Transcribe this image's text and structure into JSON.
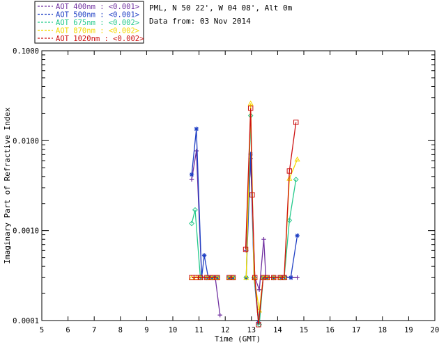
{
  "header": {
    "site_line": "PML, N 50 22', W 04 08', Alt 0m",
    "date_line": "Data from: 03 Nov 2014"
  },
  "chart_data": {
    "type": "line",
    "xlabel": "Time (GMT)",
    "ylabel": "Imaginary Part of Refractive Index",
    "xlim": [
      5,
      20
    ],
    "ylim": [
      0.0001,
      0.1
    ],
    "yscale": "log",
    "xticks": [
      "5",
      "6",
      "7",
      "8",
      "9",
      "10",
      "11",
      "12",
      "13",
      "14",
      "15",
      "16",
      "17",
      "18",
      "19",
      "20"
    ],
    "yticks": [
      "0.0001",
      "0.0010",
      "0.0100",
      "0.1000"
    ],
    "legend_position": "top-left, outside plot",
    "series": [
      {
        "name": "AOT  400nm : <0.001>",
        "color": "#7030a0",
        "marker": "plus",
        "points": [
          [
            10.72,
            0.0037
          ],
          [
            10.9,
            0.0077
          ],
          [
            11.1,
            0.0003
          ],
          [
            11.27,
            0.0003
          ],
          [
            11.45,
            0.0003
          ],
          [
            11.62,
            0.0003
          ],
          [
            11.8,
            0.000115
          ],
          [
            null,
            null
          ],
          [
            12.15,
            0.0003
          ],
          [
            12.3,
            0.0003
          ],
          [
            null,
            null
          ],
          [
            12.8,
            0.0006
          ],
          [
            12.97,
            0.0063
          ],
          [
            13.13,
            0.0003
          ],
          [
            13.3,
            0.00022
          ],
          [
            13.47,
            0.0008
          ],
          [
            13.55,
            0.0003
          ],
          [
            13.85,
            0.0003
          ],
          [
            14.05,
            0.0003
          ],
          [
            14.25,
            0.0003
          ],
          [
            14.55,
            0.0003
          ],
          [
            14.75,
            0.0003
          ]
        ]
      },
      {
        "name": "AOT  500nm : <0.001>",
        "color": "#1f3fc4",
        "marker": "asterisk",
        "points": [
          [
            10.72,
            0.0042
          ],
          [
            10.9,
            0.0135
          ],
          [
            11.1,
            0.0003
          ],
          [
            11.2,
            0.00053
          ],
          [
            11.35,
            0.0003
          ],
          [
            11.5,
            0.0003
          ],
          [
            11.7,
            0.0003
          ],
          [
            null,
            null
          ],
          [
            12.15,
            0.0003
          ],
          [
            12.3,
            0.0003
          ],
          [
            null,
            null
          ],
          [
            12.8,
            0.0003
          ],
          [
            12.97,
            0.0071
          ],
          [
            13.1,
            0.0003
          ],
          [
            13.27,
            9.5e-05
          ],
          [
            13.45,
            0.0003
          ],
          [
            13.6,
            0.0003
          ],
          [
            13.85,
            0.0003
          ],
          [
            14.15,
            0.0003
          ],
          [
            14.3,
            0.0003
          ],
          [
            14.5,
            0.0003
          ],
          [
            14.75,
            0.00088
          ]
        ]
      },
      {
        "name": "AOT  675nm : <0.002>",
        "color": "#22c98a",
        "marker": "diamond",
        "points": [
          [
            10.72,
            0.0012
          ],
          [
            10.85,
            0.0017
          ],
          [
            11.05,
            0.0003
          ],
          [
            11.3,
            0.0003
          ],
          [
            11.5,
            0.0003
          ],
          [
            11.7,
            0.0003
          ],
          [
            null,
            null
          ],
          [
            12.15,
            0.0003
          ],
          [
            12.3,
            0.0003
          ],
          [
            null,
            null
          ],
          [
            12.8,
            0.0003
          ],
          [
            12.97,
            0.019
          ],
          [
            13.1,
            0.0003
          ],
          [
            13.3,
            9e-05
          ],
          [
            13.45,
            0.0003
          ],
          [
            13.6,
            0.0003
          ],
          [
            13.85,
            0.0003
          ],
          [
            14.1,
            0.0003
          ],
          [
            14.25,
            0.0003
          ],
          [
            14.45,
            0.0013
          ],
          [
            14.7,
            0.0037
          ]
        ]
      },
      {
        "name": "AOT  870nm : <0.002>",
        "color": "#f5d800",
        "marker": "triangle",
        "points": [
          [
            10.72,
            0.0003
          ],
          [
            10.9,
            0.0003
          ],
          [
            11.05,
            0.0003
          ],
          [
            11.3,
            0.0003
          ],
          [
            11.5,
            0.0003
          ],
          [
            11.7,
            0.0003
          ],
          [
            null,
            null
          ],
          [
            12.15,
            0.0003
          ],
          [
            12.3,
            0.0003
          ],
          [
            null,
            null
          ],
          [
            12.8,
            0.0003
          ],
          [
            12.97,
            0.026
          ],
          [
            13.1,
            0.0003
          ],
          [
            13.3,
            0.00013
          ],
          [
            13.45,
            0.0003
          ],
          [
            13.6,
            0.0003
          ],
          [
            13.85,
            0.0003
          ],
          [
            14.1,
            0.0003
          ],
          [
            14.25,
            0.0003
          ],
          [
            14.45,
            0.0038
          ],
          [
            14.75,
            0.0062
          ]
        ]
      },
      {
        "name": "AOT 1020nm : <0.002>",
        "color": "#cc1010",
        "marker": "square",
        "points": [
          [
            10.72,
            0.0003
          ],
          [
            10.9,
            0.0003
          ],
          [
            11.05,
            0.0003
          ],
          [
            11.3,
            0.0003
          ],
          [
            11.5,
            0.0003
          ],
          [
            11.7,
            0.0003
          ],
          [
            null,
            null
          ],
          [
            12.15,
            0.0003
          ],
          [
            12.3,
            0.0003
          ],
          [
            null,
            null
          ],
          [
            12.78,
            0.00062
          ],
          [
            12.97,
            0.023
          ],
          [
            13.03,
            0.0025
          ],
          [
            13.13,
            0.0003
          ],
          [
            13.27,
            9e-05
          ],
          [
            13.45,
            0.0003
          ],
          [
            13.6,
            0.0003
          ],
          [
            13.85,
            0.0003
          ],
          [
            14.1,
            0.0003
          ],
          [
            14.25,
            0.0003
          ],
          [
            14.45,
            0.0046
          ],
          [
            14.7,
            0.016
          ]
        ]
      }
    ]
  }
}
